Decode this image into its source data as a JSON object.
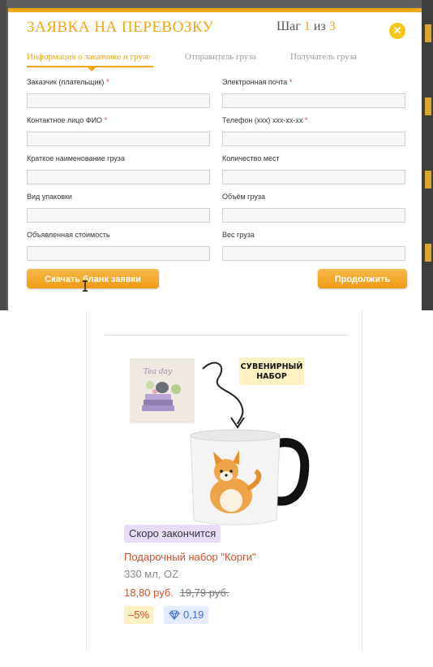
{
  "modal": {
    "title": "ЗАЯВКА НА ПЕРЕВОЗКУ",
    "step_prefix": "Шаг",
    "step_current": "1",
    "step_of": "из",
    "step_total": "3",
    "tabs": [
      {
        "label": "Информация о заказчике и грузе",
        "active": true
      },
      {
        "label": "Отправитель груза",
        "active": false
      },
      {
        "label": "Получатель груза",
        "active": false
      }
    ],
    "fields": [
      {
        "label": "Заказчик (плательщик)",
        "required_mark": "*",
        "value": ""
      },
      {
        "label": "Электронная почта",
        "required_mark": "*",
        "value": ""
      },
      {
        "label": "Контактное лицо ФИО",
        "required_mark": "*",
        "value": ""
      },
      {
        "label": "Телефон (xxx) xxx-xx-xx",
        "required_mark": "*",
        "value": ""
      },
      {
        "label": "Краткое наименование груза",
        "required_mark": "",
        "value": ""
      },
      {
        "label": "Количество мест",
        "required_mark": "",
        "value": ""
      },
      {
        "label": "Вид упаковки",
        "required_mark": "",
        "value": ""
      },
      {
        "label": "Объём груза",
        "required_mark": "",
        "value": ""
      },
      {
        "label": "Объявленная стоимость",
        "required_mark": "",
        "value": ""
      },
      {
        "label": "Вес груза",
        "required_mark": "",
        "value": ""
      }
    ],
    "download_button": "Скачать бланк заявки",
    "continue_button": "Продолжить",
    "accent_color": "#f0a515"
  },
  "product": {
    "image_text_tag": "СУВЕНИРНЫЙ НАБОР",
    "image_book_text": "Tea day",
    "badge": "Скоро закончится",
    "name": "Подарочный набор \"Корги\"",
    "description": "330 мл, OZ",
    "price_current": "18,80 руб.",
    "price_old": "19,79 руб.",
    "discount": "–5%",
    "bonus": "0,19",
    "icons": [
      "diamond-icon"
    ],
    "price_color": "#d5502a"
  }
}
